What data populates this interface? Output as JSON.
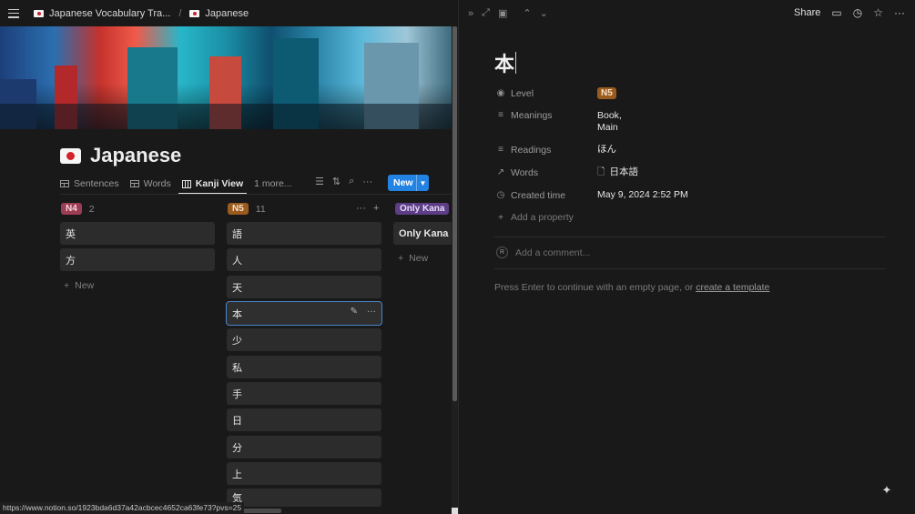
{
  "breadcrumb": {
    "items": [
      "Japanese Vocabulary Tra...",
      "Japanese"
    ],
    "separator": "/"
  },
  "database": {
    "title": "Japanese",
    "tabs": [
      {
        "label": "Sentences",
        "icon": "table-icon"
      },
      {
        "label": "Words",
        "icon": "table-icon"
      },
      {
        "label": "Kanji View",
        "icon": "board-icon",
        "active": true
      },
      {
        "label": "1 more...",
        "icon": ""
      }
    ],
    "new_button": "New"
  },
  "board": {
    "columns": [
      {
        "label": "N4",
        "count": "2",
        "color": "#9c3d55",
        "text_color": "#f3d7dd",
        "cards": [
          "英",
          "方"
        ],
        "add_label": "New"
      },
      {
        "label": "N5",
        "count": "11",
        "color": "#9a5b1f",
        "text_color": "#f8e2c8",
        "cards": [
          "語",
          "人",
          "天",
          "本",
          "少",
          "私",
          "手",
          "日",
          "分",
          "上",
          "気"
        ],
        "selected_card": "本"
      },
      {
        "label": "Only Kana",
        "count": "",
        "color": "#5d3d86",
        "text_color": "#e8dcf7",
        "cards": [
          "Only Kana"
        ],
        "add_label": "New"
      }
    ]
  },
  "status_url": "https://www.notion.so/1923bda6d37a42acbcec4652ca63fe73?pvs=25",
  "page": {
    "title": "本",
    "share_label": "Share",
    "properties": [
      {
        "name": "Level",
        "icon": "status-icon",
        "value": "N5"
      },
      {
        "name": "Meanings",
        "icon": "text-icon",
        "value": "Book,",
        "value2": "Main"
      },
      {
        "name": "Readings",
        "icon": "text-icon",
        "value": "ほん"
      },
      {
        "name": "Words",
        "icon": "relation-icon",
        "value": "日本語"
      },
      {
        "name": "Created time",
        "icon": "clock-icon",
        "value": "May 9, 2024 2:52 PM"
      }
    ],
    "add_property": "Add a property",
    "avatar_initial": "R",
    "comment_placeholder": "Add a comment...",
    "hint_prefix": "Press Enter to continue with an empty page, or ",
    "hint_link": "create a template"
  },
  "colors": {
    "background": "#191919",
    "card": "#2c2c2c",
    "accent": "#2383e2",
    "n5_badge": "#9a5b1f"
  }
}
